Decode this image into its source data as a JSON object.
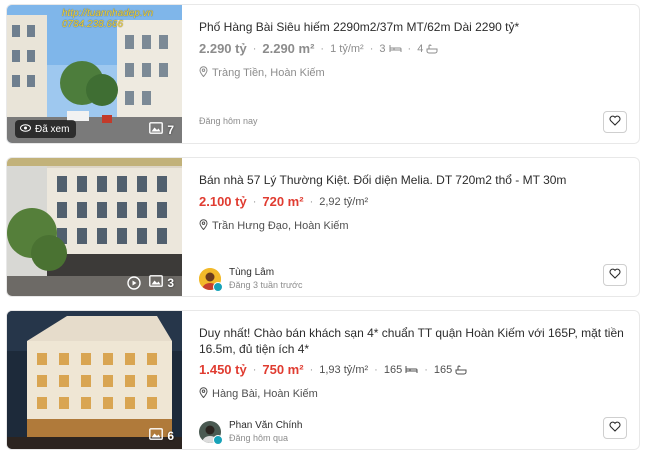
{
  "listings": [
    {
      "title": "Phố Hàng Bài Siêu hiếm 2290m2/37m MT/62m Dài 2290 tỷ*",
      "price": "2.290 tỷ",
      "area": "2.290 m²",
      "price_per_m2": "1 tỷ/m²",
      "bedrooms": "3",
      "bathrooms": "4",
      "location": "Tràng Tiền, Hoàn Kiếm",
      "posted": "Đăng hôm nay",
      "seen_label": "Đã xem",
      "image_count": "7",
      "watermark_line1": "http://tuannhadep.vn",
      "watermark_line2": "0784.238.666",
      "bedroom_icon": "bed-icon",
      "bathroom_icon": "bathtub-icon"
    },
    {
      "title": "Bán nhà 57 Lý Thường Kiệt. Đối diện Melia. DT 720m2 thổ - MT 30m",
      "price": "2.100 tỷ",
      "area": "720 m²",
      "price_per_m2": "2,92 tỷ/m²",
      "location": "Trần Hưng Đạo, Hoàn Kiếm",
      "agent_name": "Tùng Lâm",
      "posted": "Đăng 3 tuần trước",
      "image_count": "3",
      "has_video": true
    },
    {
      "title": "Duy nhất! Chào bán khách sạn 4* chuẩn TT quận Hoàn Kiếm với 165P, mặt tiền 16.5m, đủ tiện ích 4*",
      "price": "1.450 tỷ",
      "area": "750 m²",
      "price_per_m2": "1,93 tỷ/m²",
      "bedrooms": "165",
      "bathrooms": "165",
      "location": "Hàng Bài, Hoàn Kiếm",
      "agent_name": "Phan Văn Chính",
      "posted": "Đăng hôm qua",
      "image_count": "6"
    }
  ],
  "colors": {
    "price_highlight": "#e03c31",
    "price_muted": "#8c8c8c",
    "border": "#e8e8e8"
  }
}
